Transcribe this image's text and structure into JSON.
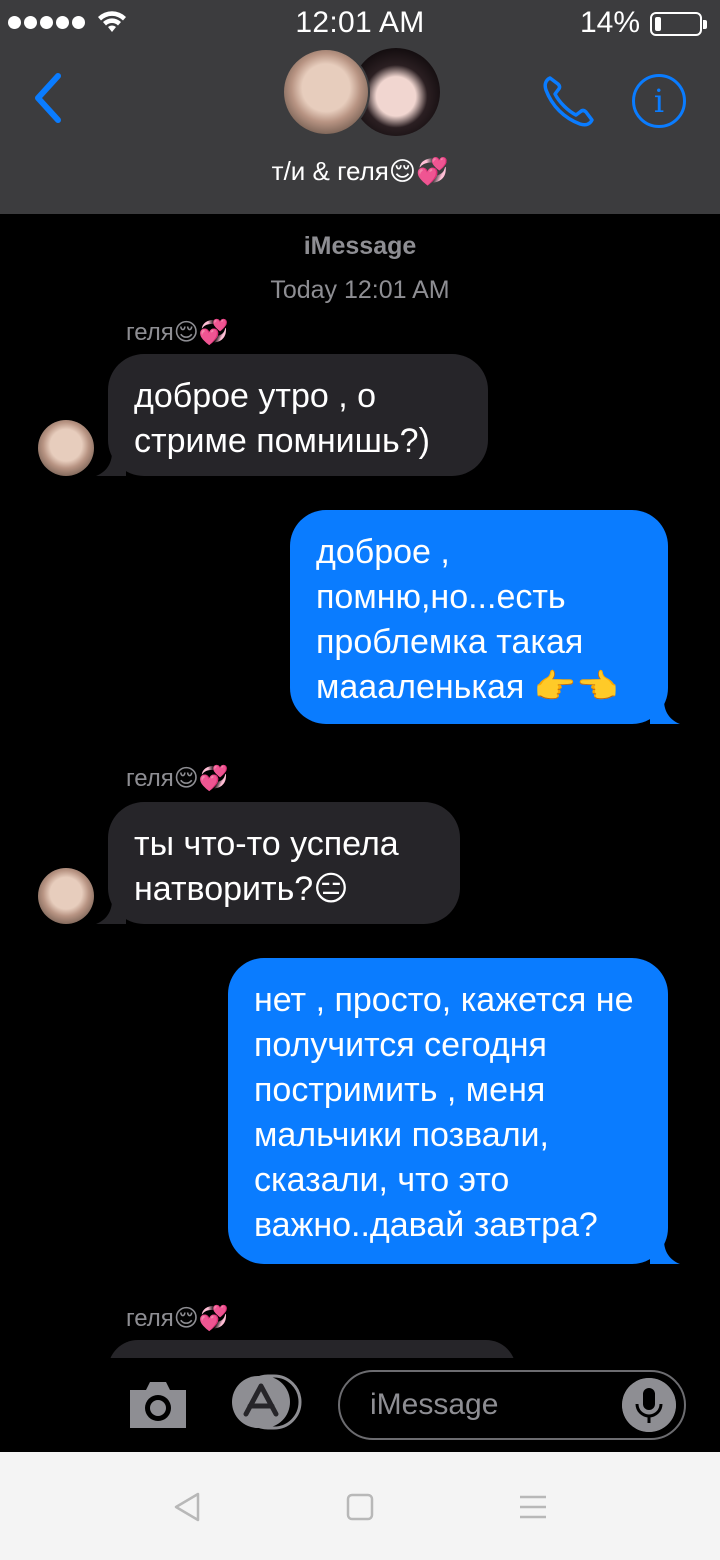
{
  "status_bar": {
    "time": "12:01 AM",
    "battery_percent": "14%",
    "signal_bars": 5,
    "battery_level": 0.14
  },
  "header": {
    "title": "т/и & геля😌💞",
    "icons": [
      "back-chevron-icon",
      "phone-icon",
      "info-icon"
    ]
  },
  "conversation": {
    "service_label": "iMessage",
    "timestamp": "Today 12:01 AM",
    "messages": [
      {
        "direction": "incoming",
        "sender": "геля😌💞",
        "text": "доброе утро , о стриме помнишь?)"
      },
      {
        "direction": "outgoing",
        "text": "доброе , помню,но...есть проблемка такая маааленькая 👉👈"
      },
      {
        "direction": "incoming",
        "sender": "геля😌💞",
        "text": "ты что-то успела натворить?😑"
      },
      {
        "direction": "outgoing",
        "text": "нет , просто, кажется не получится сегодня постримить , меня мальчики позвали, сказали, что это важно..давай завтра?"
      },
      {
        "direction": "incoming",
        "sender": "геля😌💞",
        "text": ""
      }
    ]
  },
  "compose": {
    "placeholder": "iMessage",
    "icons": [
      "camera-icon",
      "app-store-icon",
      "microphone-icon"
    ]
  },
  "colors": {
    "header_bg": "#3c3c3e",
    "incoming_bubble": "#262529",
    "outgoing_bubble": "#0a7cff",
    "accent": "#0a7cff"
  }
}
